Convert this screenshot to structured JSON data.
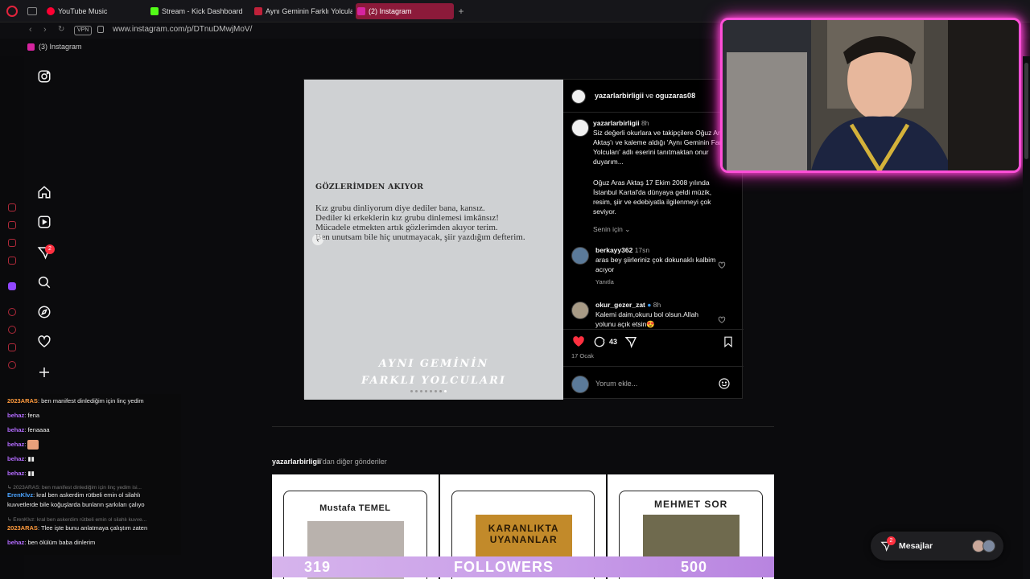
{
  "browser": {
    "tabs": [
      {
        "label": "YouTube Music",
        "color": "#ff0033"
      },
      {
        "label": "Stream - Kick Dashboard",
        "color": "#53fc18"
      },
      {
        "label": "Aynı Geminin Farklı Yolcula",
        "color": "#c0213a"
      },
      {
        "label": "(2) Instagram",
        "color": "#d6249f"
      }
    ],
    "vpn": "VPN",
    "url": "www.instagram.com/p/DTnuDMwjMoV/",
    "bookmark": "(3) Instagram"
  },
  "ig_nav": {
    "notification_count": "2"
  },
  "post": {
    "image": {
      "title": "GÖZLERİMDEN AKIYOR",
      "lines": [
        "Kız grubu dinliyorum diye dediler bana, kansız.",
        "Dediler ki erkeklerin kız grubu dinlemesi imkânsız!",
        "Mücadele etmekten artık gözlerimden akıyor terim.",
        "Ben unutsam bile hiç unutmayacak, şiir yazdığım defterim."
      ],
      "brand_line1": "AYNI GEMİNİN",
      "brand_line2": "FARKLI YOLCULARI"
    },
    "header": {
      "user": "yazarlarbirligii",
      "joiner": " ve ",
      "collab": "oguzaras08"
    },
    "caption": {
      "user": "yazarlarbirligii",
      "time": "8h",
      "p1": "Siz değerli okurlara ve takipçilere Oğuz Aras Aktaş'ı ve kaleme aldığı 'Aynı Geminin Farklı Yolcuları' adlı eserini tanıtmaktan onur duyarım...",
      "p2": "Oğuz Aras Aktaş 17 Ekim 2008 yılında İstanbul Kartal'da dünyaya geldi müzik, resim, şiir ve edebiyatla ilgilenmeyi çok seviyor.",
      "see_translation": "Senin için"
    },
    "comments": [
      {
        "user": "berkayy362",
        "time": "17sn",
        "text": "aras bey şiirleriniz çok dokunaklı kalbim acıyor",
        "reply": "Yanıtla"
      },
      {
        "user": "okur_gezer_zat",
        "time": "8h",
        "text": "Kalemi daim,okuru bol olsun.Allah yolunu açık etsin😍"
      }
    ],
    "comment_count": "43",
    "date": "17 Ocak",
    "comment_placeholder": "Yorum ekle..."
  },
  "more_posts": {
    "author": "yazarlarbirligii",
    "suffix": "'dan diğer gönderiler",
    "cells": [
      {
        "title": "Mustafa TEMEL"
      },
      {
        "title": "KARANLIKTA UYANANLAR"
      },
      {
        "title": "MEHMET SOR"
      }
    ]
  },
  "overlay_followers": {
    "current": "319",
    "label": "FOLLOWERS",
    "goal": "500"
  },
  "chat": [
    {
      "user": "2023ARAS",
      "color": "#ff9b3d",
      "text": "ben manifest dinlediğim için linç yedim"
    },
    {
      "user": "behaz",
      "color": "#b36bff",
      "text": "fena"
    },
    {
      "user": "behaz",
      "color": "#b36bff",
      "text": "fenaaaa"
    },
    {
      "user": "behaz",
      "color": "#b36bff",
      "text": ""
    },
    {
      "user": "behaz",
      "color": "#b36bff",
      "text": ""
    },
    {
      "user": "behaz",
      "color": "#b36bff",
      "text": ""
    },
    {
      "user": "ErenKlvz",
      "color": "#4aa3ff",
      "text": "kral ben askerdim rütbeli emin ol silahlı kuvvetlerde bile koğuşlarda bunların şarkıları çalıyo"
    },
    {
      "user": "2023ARAS",
      "color": "#ff9b3d",
      "text": "Tlee işte bunu anlatmaya çalıştım zaten"
    },
    {
      "user": "behaz",
      "color": "#b36bff",
      "text": "ben ölülüm baba dinlerim"
    }
  ],
  "chat_reply_context_1": "↳ 2023ARAS: ben manifest dinlediğim için linç yedim isi...",
  "chat_reply_context_2": "↳ ErenKlvz: kral ben askerdim rütbeli emin ol silahlı kuvve...",
  "messages": {
    "label": "Mesajlar",
    "badge": "2"
  },
  "colors": {
    "accent_pink": "#ff4fd8",
    "like_red": "#ff3040",
    "ig_bg": "#000000"
  }
}
